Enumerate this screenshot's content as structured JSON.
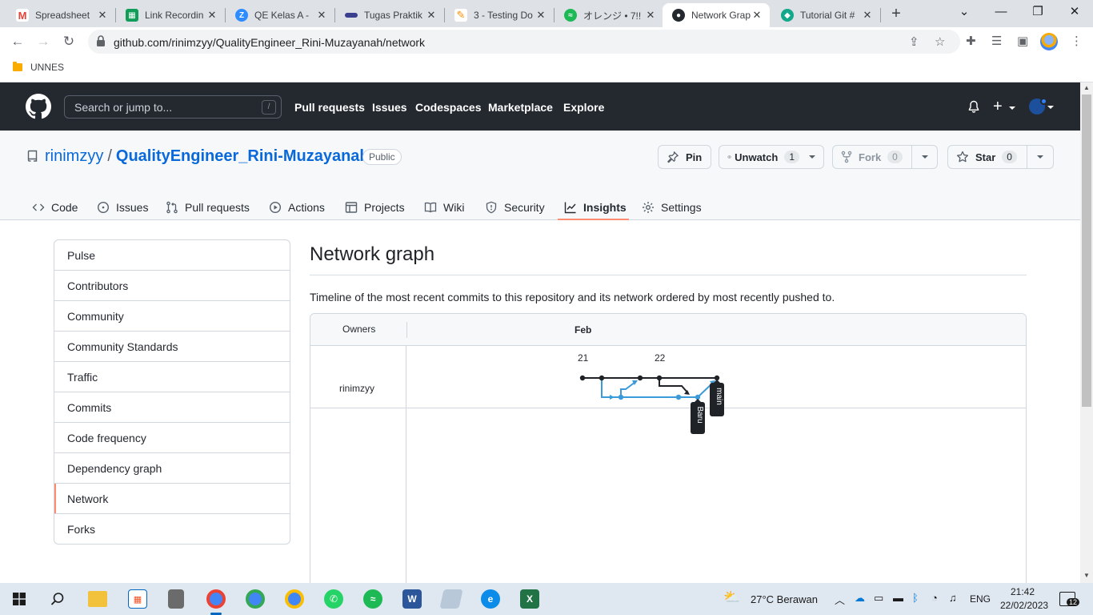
{
  "browser": {
    "tabs": [
      {
        "title": "Spreadsheet",
        "icon": "gmail-icon",
        "color": "#ea4335"
      },
      {
        "title": "Link Recordin",
        "icon": "sheets-icon",
        "color": "#0f9d58"
      },
      {
        "title": "QE Kelas A - ",
        "icon": "zoom-icon",
        "color": "#2d8cff"
      },
      {
        "title": "Tugas Praktik",
        "icon": "slides-icon",
        "color": "#3a3f8f"
      },
      {
        "title": "3 - Testing Do",
        "icon": "notepad-icon",
        "color": "#ff8a00"
      },
      {
        "title": "オレンジ • 7!!",
        "icon": "spotify-icon",
        "color": "#1db954"
      },
      {
        "title": "Network Grap",
        "icon": "github-icon",
        "color": "#24292f"
      },
      {
        "title": "Tutorial Git #",
        "icon": "web-icon",
        "color": "#12a88a"
      }
    ],
    "url": "github.com/rinimzyy/QualityEngineer_Rini-Muzayanah/network",
    "bookmark": "UNNES"
  },
  "gh": {
    "search_placeholder": "Search or jump to...",
    "search_key": "/",
    "nav": [
      "Pull requests",
      "Issues",
      "Codespaces",
      "Marketplace",
      "Explore"
    ]
  },
  "repo": {
    "owner": "rinimzyy",
    "sep": "/",
    "name": "QualityEngineer_Rini-Muzayanah",
    "visibility": "Public",
    "pin": "Pin",
    "unwatch": "Unwatch",
    "watch_count": "1",
    "fork": "Fork",
    "fork_count": "0",
    "star": "Star",
    "star_count": "0",
    "tabs": [
      "Code",
      "Issues",
      "Pull requests",
      "Actions",
      "Projects",
      "Wiki",
      "Security",
      "Insights",
      "Settings"
    ],
    "selected_tab": "Insights"
  },
  "sidebar": {
    "items": [
      "Pulse",
      "Contributors",
      "Community",
      "Community Standards",
      "Traffic",
      "Commits",
      "Code frequency",
      "Dependency graph",
      "Network",
      "Forks"
    ],
    "selected": "Network"
  },
  "main": {
    "title": "Network graph",
    "description": "Timeline of the most recent commits to this repository and its network ordered by most recently pushed to.",
    "owners_header": "Owners",
    "month": "Feb",
    "days": [
      "21",
      "22"
    ],
    "owner": "rinimzyy",
    "branches": [
      {
        "name": "main",
        "color": "#1f2328"
      },
      {
        "name": "Baru",
        "color": "#3b9ad9"
      }
    ]
  },
  "taskbar": {
    "weather": "27°C  Berawan",
    "lang": "ENG",
    "time": "21:42",
    "date": "22/02/2023",
    "notifications": "12"
  }
}
